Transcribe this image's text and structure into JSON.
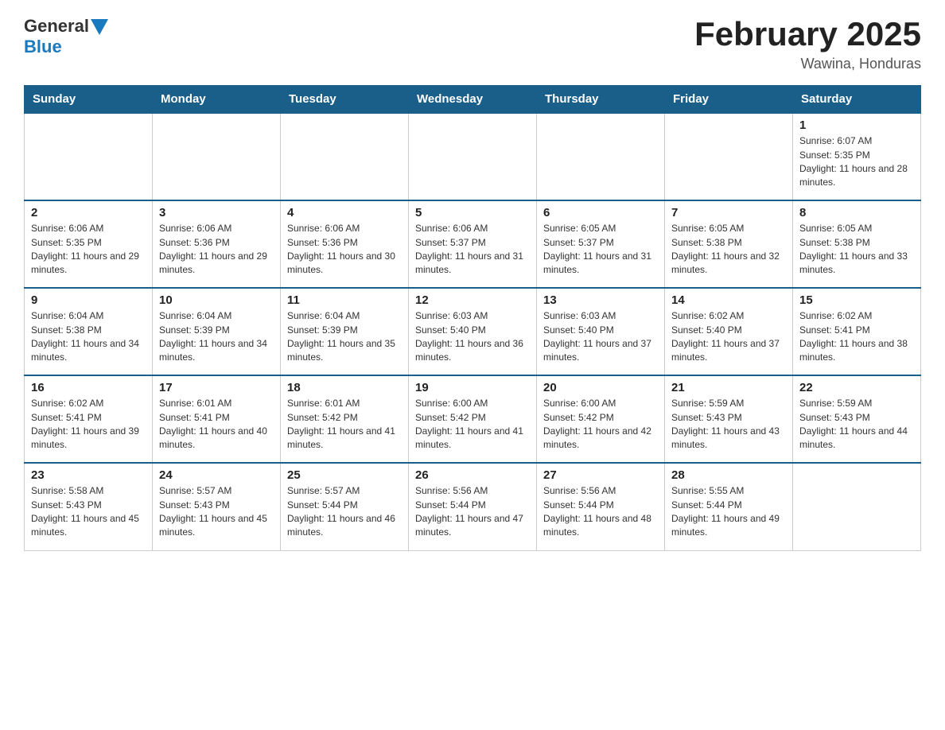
{
  "header": {
    "logo_general": "General",
    "logo_blue": "Blue",
    "title": "February 2025",
    "subtitle": "Wawina, Honduras"
  },
  "days_of_week": [
    "Sunday",
    "Monday",
    "Tuesday",
    "Wednesday",
    "Thursday",
    "Friday",
    "Saturday"
  ],
  "weeks": [
    [
      {
        "day": "",
        "info": ""
      },
      {
        "day": "",
        "info": ""
      },
      {
        "day": "",
        "info": ""
      },
      {
        "day": "",
        "info": ""
      },
      {
        "day": "",
        "info": ""
      },
      {
        "day": "",
        "info": ""
      },
      {
        "day": "1",
        "info": "Sunrise: 6:07 AM\nSunset: 5:35 PM\nDaylight: 11 hours and 28 minutes."
      }
    ],
    [
      {
        "day": "2",
        "info": "Sunrise: 6:06 AM\nSunset: 5:35 PM\nDaylight: 11 hours and 29 minutes."
      },
      {
        "day": "3",
        "info": "Sunrise: 6:06 AM\nSunset: 5:36 PM\nDaylight: 11 hours and 29 minutes."
      },
      {
        "day": "4",
        "info": "Sunrise: 6:06 AM\nSunset: 5:36 PM\nDaylight: 11 hours and 30 minutes."
      },
      {
        "day": "5",
        "info": "Sunrise: 6:06 AM\nSunset: 5:37 PM\nDaylight: 11 hours and 31 minutes."
      },
      {
        "day": "6",
        "info": "Sunrise: 6:05 AM\nSunset: 5:37 PM\nDaylight: 11 hours and 31 minutes."
      },
      {
        "day": "7",
        "info": "Sunrise: 6:05 AM\nSunset: 5:38 PM\nDaylight: 11 hours and 32 minutes."
      },
      {
        "day": "8",
        "info": "Sunrise: 6:05 AM\nSunset: 5:38 PM\nDaylight: 11 hours and 33 minutes."
      }
    ],
    [
      {
        "day": "9",
        "info": "Sunrise: 6:04 AM\nSunset: 5:38 PM\nDaylight: 11 hours and 34 minutes."
      },
      {
        "day": "10",
        "info": "Sunrise: 6:04 AM\nSunset: 5:39 PM\nDaylight: 11 hours and 34 minutes."
      },
      {
        "day": "11",
        "info": "Sunrise: 6:04 AM\nSunset: 5:39 PM\nDaylight: 11 hours and 35 minutes."
      },
      {
        "day": "12",
        "info": "Sunrise: 6:03 AM\nSunset: 5:40 PM\nDaylight: 11 hours and 36 minutes."
      },
      {
        "day": "13",
        "info": "Sunrise: 6:03 AM\nSunset: 5:40 PM\nDaylight: 11 hours and 37 minutes."
      },
      {
        "day": "14",
        "info": "Sunrise: 6:02 AM\nSunset: 5:40 PM\nDaylight: 11 hours and 37 minutes."
      },
      {
        "day": "15",
        "info": "Sunrise: 6:02 AM\nSunset: 5:41 PM\nDaylight: 11 hours and 38 minutes."
      }
    ],
    [
      {
        "day": "16",
        "info": "Sunrise: 6:02 AM\nSunset: 5:41 PM\nDaylight: 11 hours and 39 minutes."
      },
      {
        "day": "17",
        "info": "Sunrise: 6:01 AM\nSunset: 5:41 PM\nDaylight: 11 hours and 40 minutes."
      },
      {
        "day": "18",
        "info": "Sunrise: 6:01 AM\nSunset: 5:42 PM\nDaylight: 11 hours and 41 minutes."
      },
      {
        "day": "19",
        "info": "Sunrise: 6:00 AM\nSunset: 5:42 PM\nDaylight: 11 hours and 41 minutes."
      },
      {
        "day": "20",
        "info": "Sunrise: 6:00 AM\nSunset: 5:42 PM\nDaylight: 11 hours and 42 minutes."
      },
      {
        "day": "21",
        "info": "Sunrise: 5:59 AM\nSunset: 5:43 PM\nDaylight: 11 hours and 43 minutes."
      },
      {
        "day": "22",
        "info": "Sunrise: 5:59 AM\nSunset: 5:43 PM\nDaylight: 11 hours and 44 minutes."
      }
    ],
    [
      {
        "day": "23",
        "info": "Sunrise: 5:58 AM\nSunset: 5:43 PM\nDaylight: 11 hours and 45 minutes."
      },
      {
        "day": "24",
        "info": "Sunrise: 5:57 AM\nSunset: 5:43 PM\nDaylight: 11 hours and 45 minutes."
      },
      {
        "day": "25",
        "info": "Sunrise: 5:57 AM\nSunset: 5:44 PM\nDaylight: 11 hours and 46 minutes."
      },
      {
        "day": "26",
        "info": "Sunrise: 5:56 AM\nSunset: 5:44 PM\nDaylight: 11 hours and 47 minutes."
      },
      {
        "day": "27",
        "info": "Sunrise: 5:56 AM\nSunset: 5:44 PM\nDaylight: 11 hours and 48 minutes."
      },
      {
        "day": "28",
        "info": "Sunrise: 5:55 AM\nSunset: 5:44 PM\nDaylight: 11 hours and 49 minutes."
      },
      {
        "day": "",
        "info": ""
      }
    ]
  ]
}
